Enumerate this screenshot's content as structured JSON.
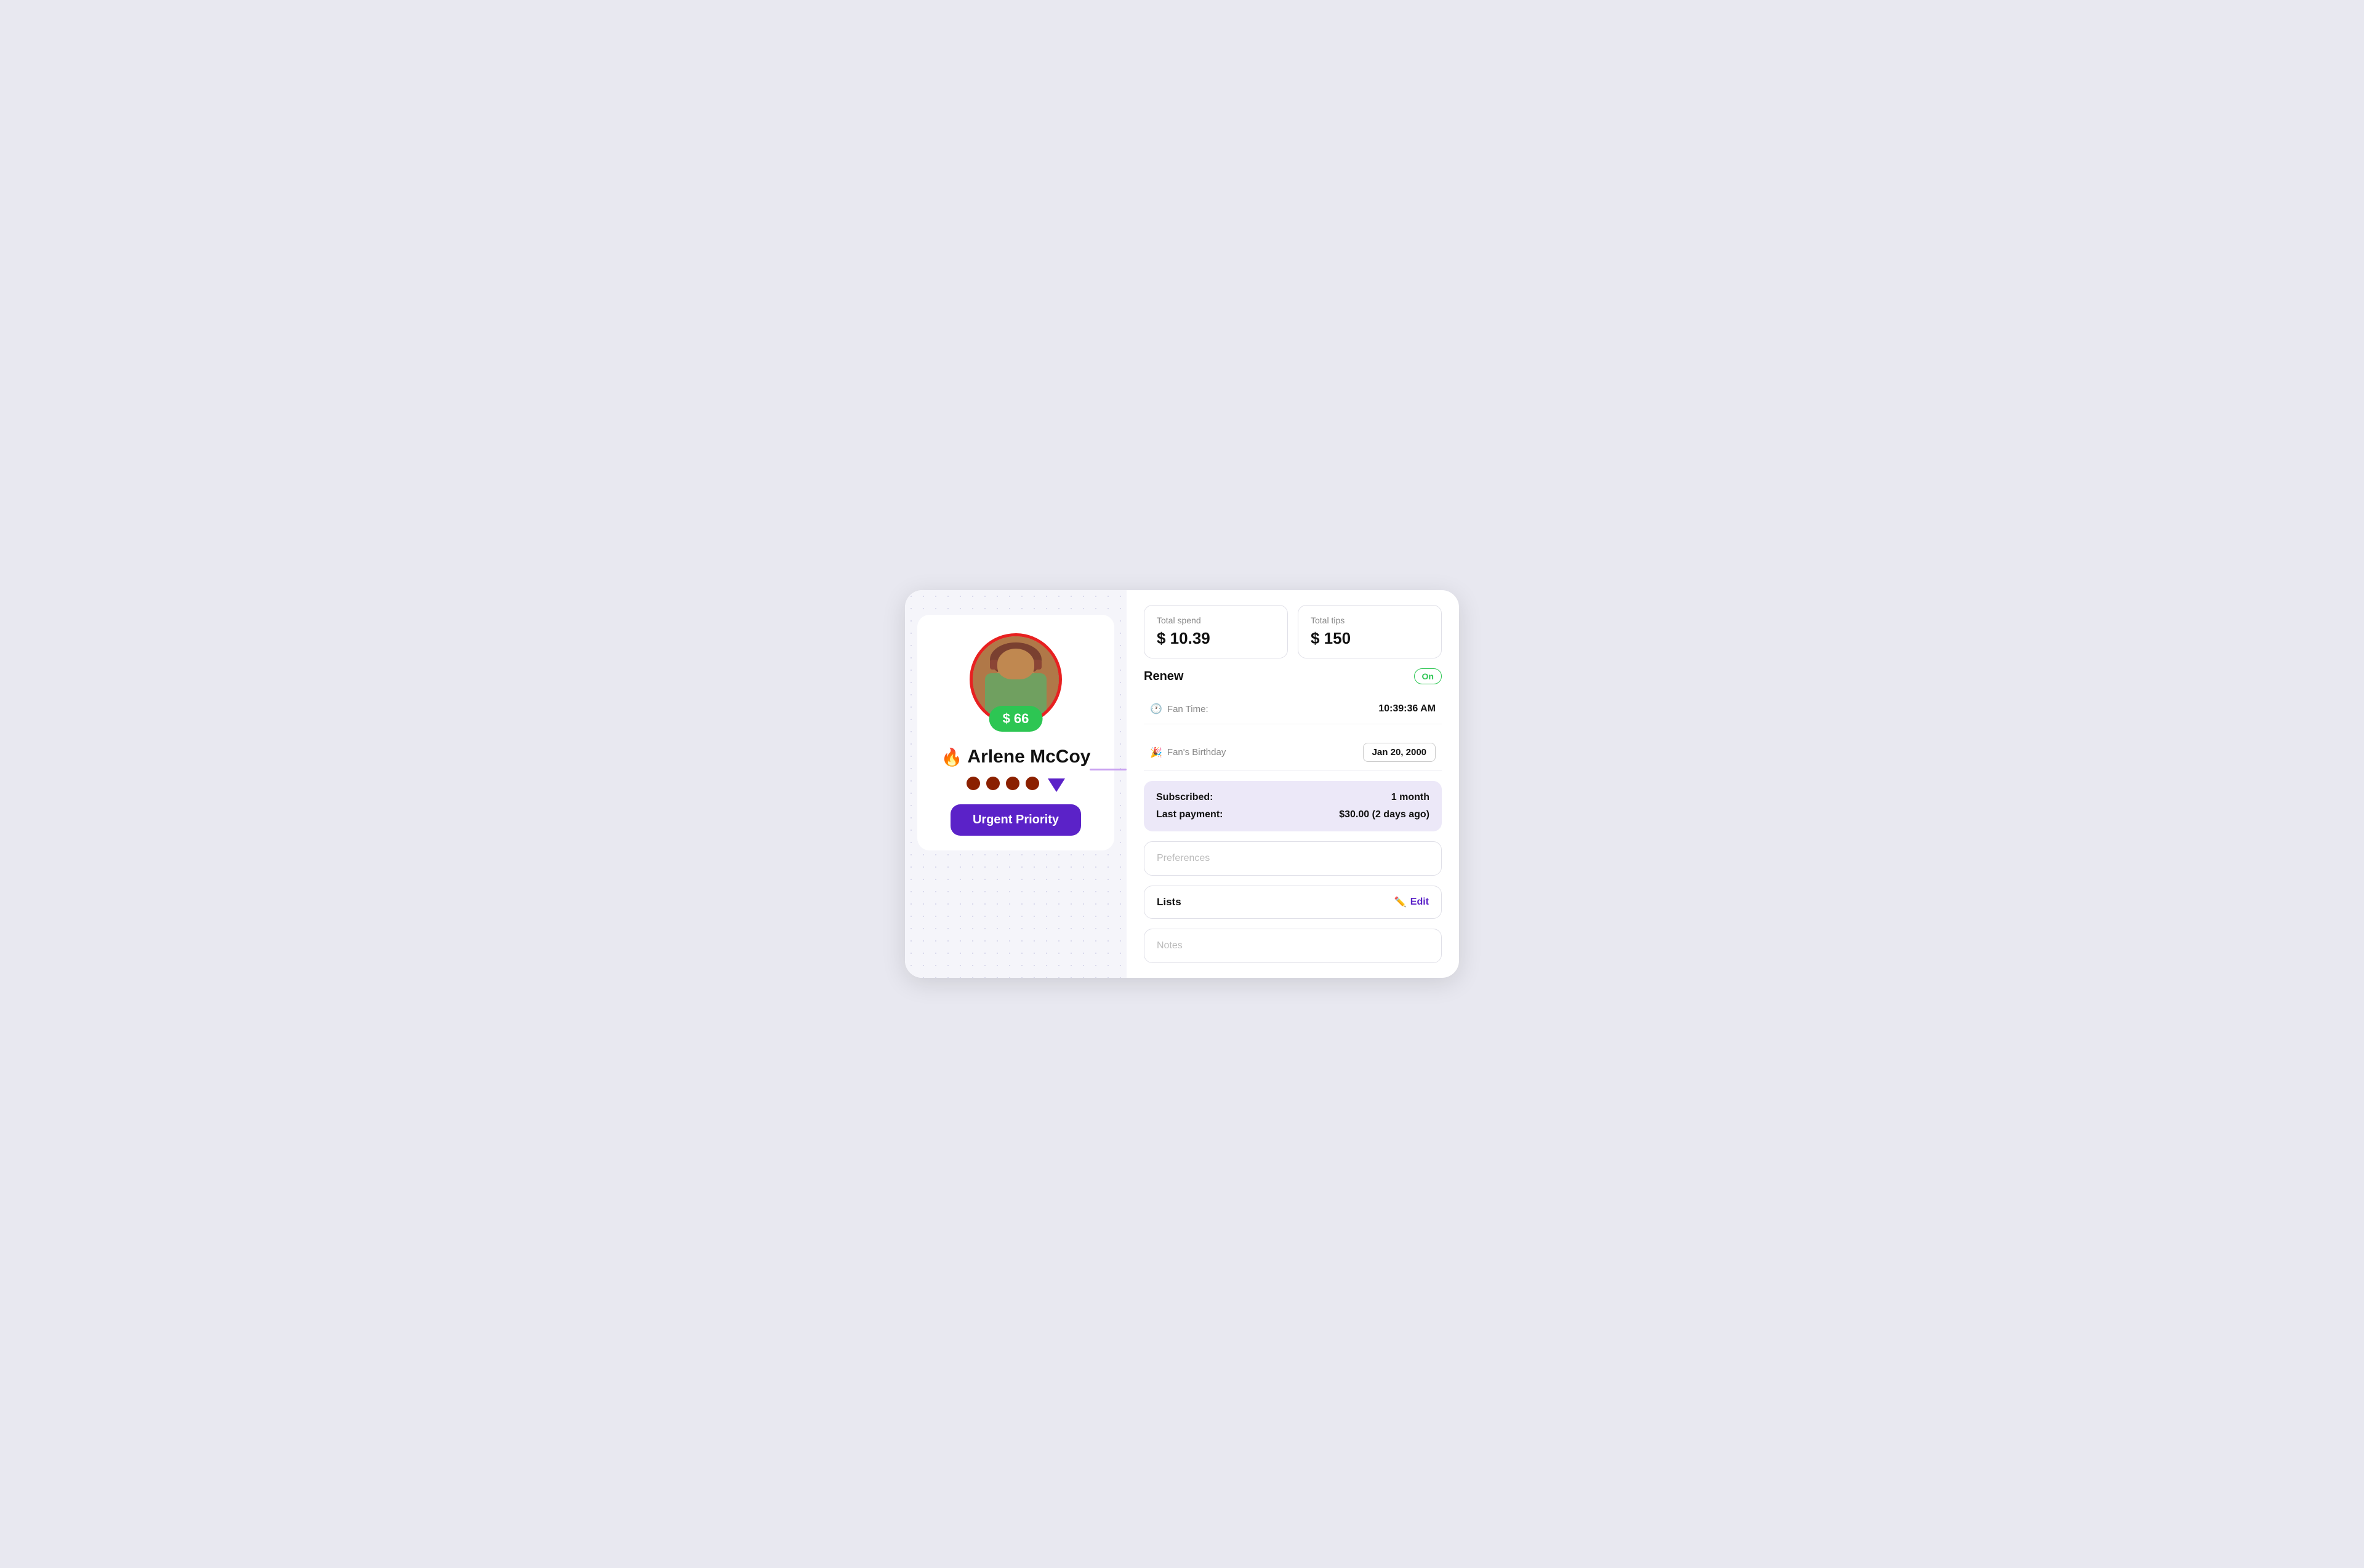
{
  "left": {
    "price_badge": "$ 66",
    "fan_name": "Arlene McCoy",
    "fire_emoji": "🔥",
    "urgent_label": "Urgent Priority"
  },
  "right": {
    "total_spend_label": "Total spend",
    "total_spend_value": "$ 10.39",
    "total_tips_label": "Total tips",
    "total_tips_value": "$ 150",
    "renew_label": "Renew",
    "renew_status": "On",
    "fan_time_label": "Fan Time:",
    "fan_time_value": "10:39:36 AM",
    "birthday_label": "Fan's Birthday",
    "birthday_value": "Jan 20, 2000",
    "subscribed_label": "Subscribed:",
    "subscribed_value": "1 month",
    "last_payment_label": "Last payment:",
    "last_payment_value": "$30.00 (2 days ago)",
    "preferences_placeholder": "Preferences",
    "lists_label": "Lists",
    "edit_label": "Edit",
    "notes_placeholder": "Notes"
  }
}
